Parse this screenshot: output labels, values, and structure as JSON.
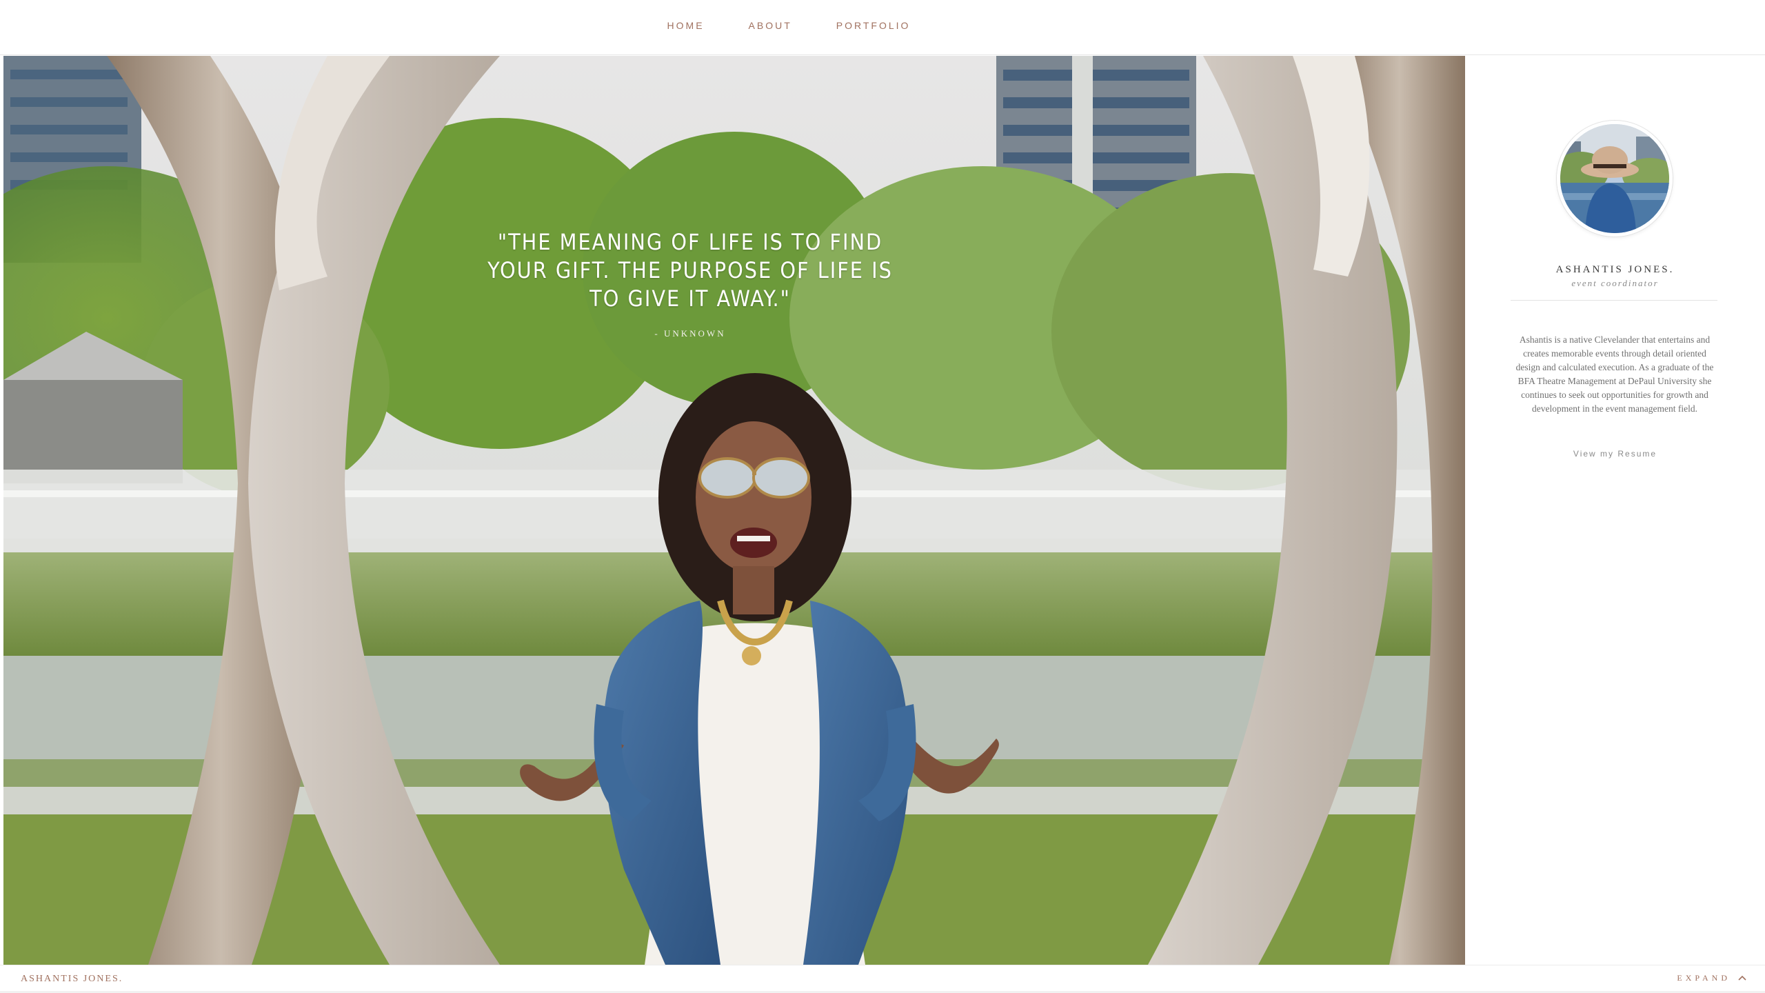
{
  "nav": {
    "items": [
      {
        "label": "HOME"
      },
      {
        "label": "ABOUT"
      },
      {
        "label": "PORTFOLIO"
      }
    ]
  },
  "hero": {
    "quote": "\"THE MEANING OF LIFE IS TO FIND YOUR GIFT. THE PURPOSE OF LIFE IS TO GIVE IT AWAY.\"",
    "quote_author": "- UNKNOWN"
  },
  "profile": {
    "name": "ASHANTIS JONES.",
    "role": "event coordinator",
    "bio": "Ashantis is a native Clevelander that entertains and creates memorable events through detail oriented design and calculated execution. As a graduate of the BFA Theatre Management at DePaul University she continues to seek out opportunities for growth and development in the event management field.",
    "resume_link": "View my Resume"
  },
  "footer": {
    "brand": "ASHANTIS JONES.",
    "expand_label": "EXPAND",
    "expand_icon": "chevron-up-icon"
  },
  "colors": {
    "accent": "#a0715f",
    "text_muted": "#707070",
    "background": "#ffffff"
  }
}
